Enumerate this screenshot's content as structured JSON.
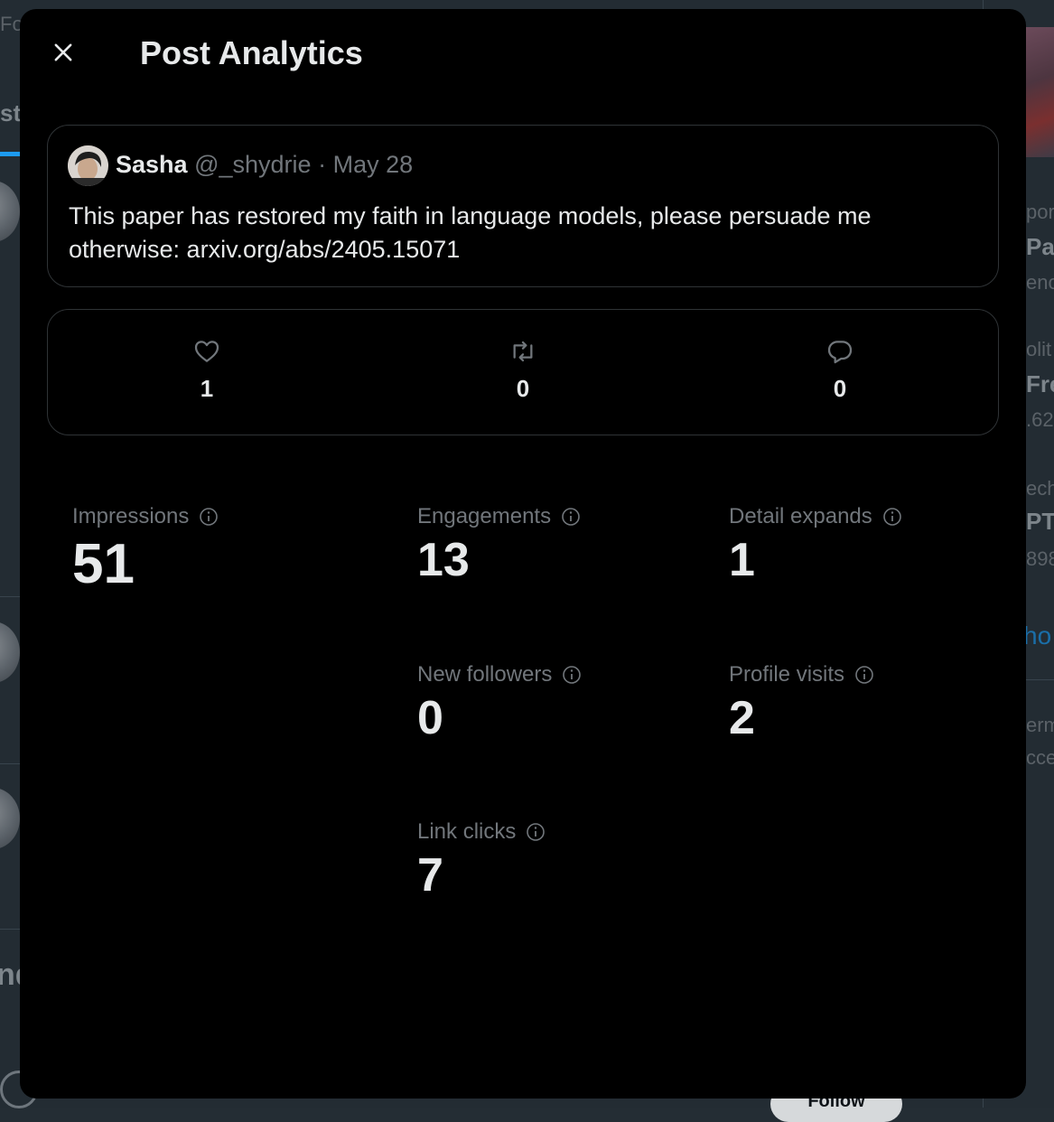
{
  "modal": {
    "title": "Post Analytics",
    "close_icon": "close-icon"
  },
  "post": {
    "author_name": "Sasha",
    "author_handle": "@_shydrie",
    "separator": "·",
    "date": "May 28",
    "text": "This paper has restored my faith in language models, please persuade me otherwise: arxiv.org/abs/2405.15071"
  },
  "engagement_counts": {
    "likes": "1",
    "reposts": "0",
    "replies": "0",
    "like_icon": "heart-icon",
    "repost_icon": "repost-icon",
    "reply_icon": "reply-icon"
  },
  "metrics": {
    "impressions": {
      "label": "Impressions",
      "value": "51"
    },
    "engagements": {
      "label": "Engagements",
      "value": "13"
    },
    "detail_expands": {
      "label": "Detail expands",
      "value": "1"
    },
    "new_followers": {
      "label": "New followers",
      "value": "0"
    },
    "profile_visits": {
      "label": "Profile visits",
      "value": "2"
    },
    "link_clicks": {
      "label": "Link clicks",
      "value": "7"
    }
  },
  "background": {
    "left_fragments": [
      "Fo",
      "st",
      "nd"
    ],
    "right_fragments": [
      "por",
      "Pa",
      "eno",
      "olit",
      "Fre",
      ".62",
      "ech",
      "PT",
      "898",
      "ho",
      "erm",
      "cce"
    ],
    "follow_label": "Follow"
  },
  "colors": {
    "modal_bg": "#000000",
    "text_primary": "#e7e9ea",
    "text_secondary": "#71767b",
    "border": "#2f3336",
    "link_blue": "#1d9bf0"
  }
}
